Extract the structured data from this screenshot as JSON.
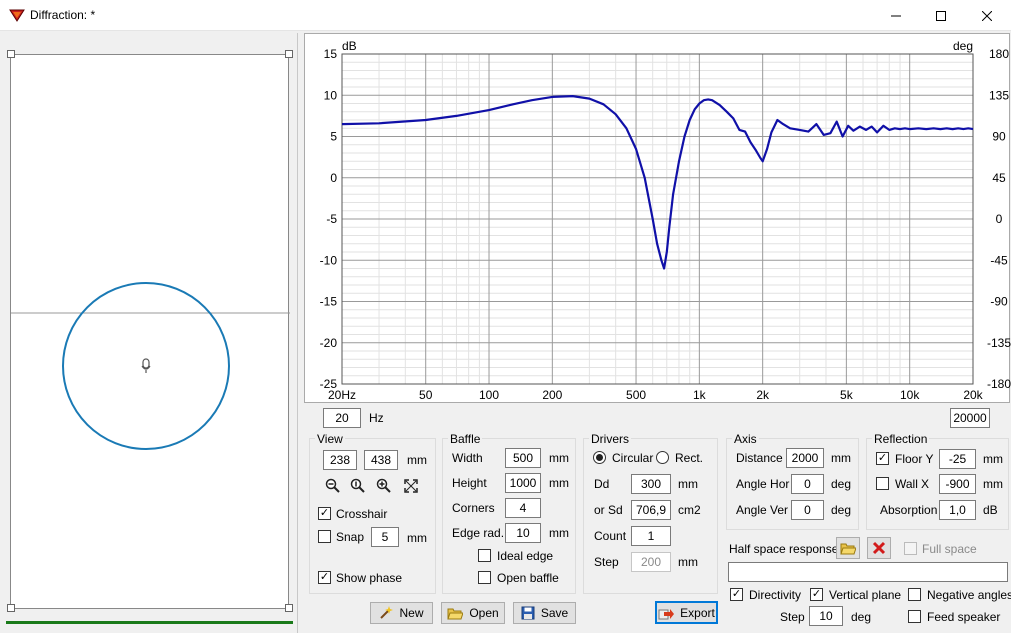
{
  "window": {
    "title": "Diffraction: *"
  },
  "chart_data": {
    "type": "line",
    "title": "",
    "ylabel_left": "dB",
    "ylabel_right": "deg",
    "x_scale": "log",
    "xlim": [
      20,
      20000
    ],
    "ylim": [
      -25,
      15
    ],
    "ylim_right": [
      -180,
      180
    ],
    "x_tick_labels": [
      "20Hz",
      "50",
      "100",
      "200",
      "500",
      "1k",
      "2k",
      "5k",
      "10k",
      "20k"
    ],
    "x_tick_values": [
      20,
      50,
      100,
      200,
      500,
      1000,
      2000,
      5000,
      10000,
      20000
    ],
    "y_ticks_left": [
      15,
      10,
      5,
      0,
      -5,
      -10,
      -15,
      -20,
      -25
    ],
    "y_ticks_right": [
      180,
      135,
      90,
      45,
      0,
      -45,
      -90,
      -135,
      -180
    ],
    "grid": true,
    "series": [
      {
        "color": "#1010a8",
        "x": [
          20,
          30,
          50,
          70,
          100,
          130,
          160,
          200,
          250,
          300,
          350,
          400,
          450,
          500,
          550,
          600,
          630,
          660,
          680,
          700,
          720,
          750,
          800,
          850,
          900,
          950,
          1000,
          1050,
          1100,
          1150,
          1250,
          1350,
          1450,
          1550,
          1650,
          1750,
          1850,
          1950,
          2000,
          2100,
          2200,
          2350,
          2500,
          2700,
          3000,
          3300,
          3600,
          3900,
          4200,
          4500,
          4800,
          5100,
          5400,
          5800,
          6200,
          6600,
          7000,
          7500,
          8000,
          8500,
          9000,
          9500,
          10000,
          11000,
          12000,
          13000,
          14000,
          15000,
          16000,
          17000,
          18000,
          19000,
          20000
        ],
        "y": [
          6.5,
          6.6,
          7.0,
          7.5,
          8.2,
          8.9,
          9.4,
          9.8,
          9.9,
          9.6,
          8.9,
          7.7,
          6.0,
          3.5,
          0.0,
          -5.0,
          -8.0,
          -10.0,
          -11.0,
          -9.0,
          -6.0,
          -2.0,
          2.0,
          5.0,
          7.0,
          8.3,
          9.0,
          9.4,
          9.5,
          9.4,
          8.8,
          8.0,
          7.2,
          5.8,
          5.6,
          4.3,
          3.4,
          2.4,
          2.0,
          3.5,
          5.5,
          7.0,
          6.5,
          6.0,
          5.8,
          5.6,
          6.5,
          5.2,
          5.4,
          6.8,
          5.0,
          6.3,
          5.7,
          6.2,
          5.8,
          6.2,
          5.5,
          6.3,
          5.8,
          6.0,
          5.9,
          6.0,
          5.9,
          6.0,
          5.9,
          6.0,
          5.9,
          6.0,
          5.9,
          6.0,
          5.9,
          6.0,
          5.9
        ]
      }
    ]
  },
  "freq": {
    "min": "20",
    "unit": "Hz",
    "max": "20000"
  },
  "view": {
    "title": "View",
    "width": "238",
    "height": "438",
    "unit": "mm",
    "crosshair_label": "Crosshair",
    "crosshair_checked": true,
    "snap_label": "Snap",
    "snap_value": "5",
    "snap_unit": "mm",
    "snap_checked": false,
    "show_phase_label": "Show phase",
    "show_phase_checked": true
  },
  "baffle": {
    "title": "Baffle",
    "width_label": "Width",
    "width": "500",
    "height_label": "Height",
    "height": "1000",
    "corners_label": "Corners",
    "corners": "4",
    "edge_label": "Edge rad.",
    "edge": "10",
    "unit": "mm",
    "ideal_edge_label": "Ideal edge",
    "open_baffle_label": "Open baffle"
  },
  "drivers": {
    "title": "Drivers",
    "circular_label": "Circular",
    "rect_label": "Rect.",
    "dd_label": "Dd",
    "dd": "300",
    "dd_unit": "mm",
    "sd_label": "or Sd",
    "sd": "706,9",
    "sd_unit": "cm2",
    "count_label": "Count",
    "count": "1",
    "step_label": "Step",
    "step": "200",
    "step_unit": "mm"
  },
  "axis": {
    "title": "Axis",
    "distance_label": "Distance",
    "distance": "2000",
    "distance_unit": "mm",
    "angle_hor_label": "Angle Hor",
    "angle_hor": "0",
    "angle_ver_label": "Angle Ver",
    "angle_ver": "0",
    "deg": "deg"
  },
  "reflection": {
    "title": "Reflection",
    "floor_label": "Floor Y",
    "floor": "-25",
    "floor_checked": true,
    "wall_label": "Wall",
    "wall_axis": "X",
    "wall": "-900",
    "wall_checked": false,
    "unit": "mm",
    "absorption_label": "Absorption",
    "absorption": "1,0",
    "absorption_unit": "dB"
  },
  "half_space": {
    "label": "Half space response",
    "full_space_label": "Full space",
    "path": ""
  },
  "options": {
    "directivity_label": "Directivity",
    "vertical_plane_label": "Vertical plane",
    "negative_angles_label": "Negative angles",
    "feed_speaker_label": "Feed speaker",
    "step_label": "Step",
    "step": "10",
    "step_unit": "deg"
  },
  "buttons": {
    "new": "New",
    "open": "Open",
    "save": "Save",
    "export": "Export"
  },
  "colors": {
    "accent": "#0078d7",
    "curve": "#1010a8",
    "driver_circle": "#1a7ab5",
    "status_bar": "#1a7a1a"
  }
}
